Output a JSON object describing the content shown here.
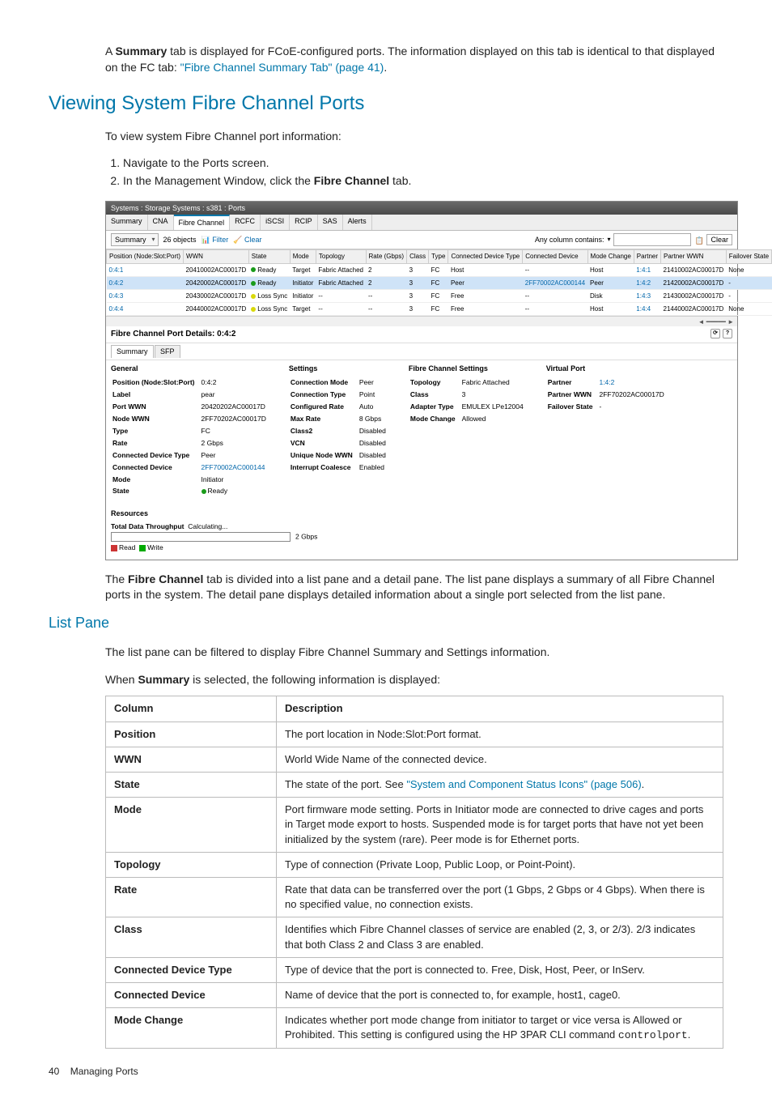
{
  "intro": {
    "prefix": "A ",
    "bold": "Summary",
    "mid": " tab is displayed for FCoE-configured ports. The information displayed on this tab is identical to that displayed on the FC tab: ",
    "link": "\"Fibre Channel Summary Tab\" (page 41)",
    "suffix": "."
  },
  "h1": "Viewing System Fibre Channel Ports",
  "lead": "To view system Fibre Channel port information:",
  "steps": {
    "s1": "Navigate to the Ports screen.",
    "s2a": "In the Management Window, click the ",
    "s2b": "Fibre Channel",
    "s2c": " tab."
  },
  "app": {
    "title": "Systems : Storage Systems : s381 : Ports",
    "tabs": [
      "Summary",
      "CNA",
      "Fibre Channel",
      "RCFC",
      "iSCSI",
      "RCIP",
      "SAS",
      "Alerts"
    ],
    "activeTab": 2,
    "toolbar": {
      "dropdown": "Summary",
      "count": "26 objects",
      "filter": "Filter",
      "clear": "Clear",
      "anycol": "Any column contains:",
      "clearbtn": "Clear"
    },
    "columns": [
      "Position (Node:Slot:Port)",
      "WWN",
      "State",
      "Mode",
      "Topology",
      "Rate (Gbps)",
      "Class",
      "Type",
      "Connected Device Type",
      "Connected Device",
      "Mode Change",
      "Partner",
      "Partner WWN",
      "Failover State"
    ],
    "rows": [
      {
        "pos": "0:4:1",
        "wwn": "20410002AC00017D",
        "stateColor": "green",
        "state": "Ready",
        "mode": "Target",
        "topo": "Fabric Attached",
        "rate": "2",
        "cls": "3",
        "type": "FC",
        "cdt": "Host",
        "cd": "--",
        "mc": "Host",
        "partner": "1:4:1",
        "pwwn": "21410002AC00017D",
        "fo": "None",
        "link": true,
        "sel": false
      },
      {
        "pos": "0:4:2",
        "wwn": "20420002AC00017D",
        "stateColor": "green",
        "state": "Ready",
        "mode": "Initiator",
        "topo": "Fabric Attached",
        "rate": "2",
        "cls": "3",
        "type": "FC",
        "cdt": "Peer",
        "cd": "2FF70002AC000144",
        "mc": "Peer",
        "partner": "1:4:2",
        "pwwn": "21420002AC00017D",
        "fo": "-",
        "link": true,
        "sel": true
      },
      {
        "pos": "0:4:3",
        "wwn": "20430002AC00017D",
        "stateColor": "orange",
        "state": "Loss Sync",
        "mode": "Initiator",
        "topo": "--",
        "rate": "--",
        "cls": "3",
        "type": "FC",
        "cdt": "Free",
        "cd": "--",
        "mc": "Disk",
        "partner": "1:4:3",
        "pwwn": "21430002AC00017D",
        "fo": "-",
        "link": false,
        "sel": false
      },
      {
        "pos": "0:4:4",
        "wwn": "20440002AC00017D",
        "stateColor": "orange",
        "state": "Loss Sync",
        "mode": "Target",
        "topo": "--",
        "rate": "--",
        "cls": "3",
        "type": "FC",
        "cdt": "Free",
        "cd": "--",
        "mc": "Host",
        "partner": "1:4:4",
        "pwwn": "21440002AC00017D",
        "fo": "None",
        "link": true,
        "sel": false
      }
    ],
    "detailTitle": "Fibre Channel Port Details: 0:4:2",
    "subtabs": [
      "Summary",
      "SFP"
    ],
    "general": {
      "hdr": "General",
      "Position (Node:Slot:Port)": "0:4:2",
      "Label": "pear",
      "Port WWN": "20420202AC00017D",
      "Node WWN": "2FF70202AC00017D",
      "Type": "FC",
      "Rate": "2 Gbps",
      "Connected Device Type": "Peer",
      "Connected Device": "2FF70002AC000144",
      "Mode": "Initiator",
      "State": "Ready"
    },
    "settings": {
      "hdr": "Settings",
      "Connection Mode": "Peer",
      "Connection Type": "Point",
      "Configured Rate": "Auto",
      "Max Rate": "8 Gbps",
      "Class2": "Disabled",
      "VCN": "Disabled",
      "Unique Node WWN": "Disabled",
      "Interrupt Coalesce": "Enabled"
    },
    "fcsettings": {
      "hdr": "Fibre Channel Settings",
      "Topology": "Fabric Attached",
      "Class": "3",
      "Adapter Type": "EMULEX LPe12004",
      "Mode Change": "Allowed"
    },
    "vport": {
      "hdr": "Virtual Port",
      "Partner": "1:4:2",
      "Partner WWN": "2FF70202AC00017D",
      "Failover State": "-"
    },
    "resourcesHdr": "Resources",
    "throughputLabel": "Total Data Throughput",
    "throughputVal": "Calculating...",
    "throughputMax": "2 Gbps",
    "legendRead": "Read",
    "legendWrite": "Write"
  },
  "afterApp": {
    "prefix": "The ",
    "bold": "Fibre Channel",
    "rest": " tab is divided into a list pane and a detail pane. The list pane displays a summary of all Fibre Channel ports in the system. The detail pane displays detailed information about a single port selected from the list pane."
  },
  "h2": "List Pane",
  "listIntro": "The list pane can be filtered to display Fibre Channel Summary and Settings information.",
  "whenSummary": {
    "a": "When ",
    "b": "Summary",
    "c": " is selected, the following information is displayed:"
  },
  "descHeaders": {
    "col": "Column",
    "desc": "Description"
  },
  "descRows": [
    {
      "k": "Position",
      "v": "The port location in Node:Slot:Port format."
    },
    {
      "k": "WWN",
      "v": "World Wide Name of the connected device."
    },
    {
      "k": "State",
      "v": "The state of the port. See ",
      "link": "\"System and Component Status Icons\" (page 506)",
      "suffix": "."
    },
    {
      "k": "Mode",
      "v": "Port firmware mode setting. Ports in Initiator mode are connected to drive cages and ports in Target mode export to hosts. Suspended mode is for target ports that have not yet been initialized by the system (rare). Peer mode is for Ethernet ports."
    },
    {
      "k": "Topology",
      "v": "Type of connection (Private Loop, Public Loop, or Point-Point)."
    },
    {
      "k": "Rate",
      "v": "Rate that data can be transferred over the port (1 Gbps, 2 Gbps or 4 Gbps). When there is no specified value, no connection exists."
    },
    {
      "k": "Class",
      "v": "Identifies which Fibre Channel classes of service are enabled (2, 3, or 2/3). 2/3 indicates that both Class 2 and Class 3 are enabled."
    },
    {
      "k": "Connected Device Type",
      "v": "Type of device that the port is connected to. Free, Disk, Host, Peer, or InServ."
    },
    {
      "k": "Connected Device",
      "v": "Name of device that the port is connected to, for example, host1, cage0."
    },
    {
      "k": "Mode Change",
      "v": "Indicates whether port mode change from initiator to target or vice versa is Allowed or Prohibited. This setting is configured using the HP 3PAR CLI command ",
      "code": "controlport",
      "suffix": "."
    }
  ],
  "footer": {
    "page": "40",
    "title": "Managing Ports"
  }
}
